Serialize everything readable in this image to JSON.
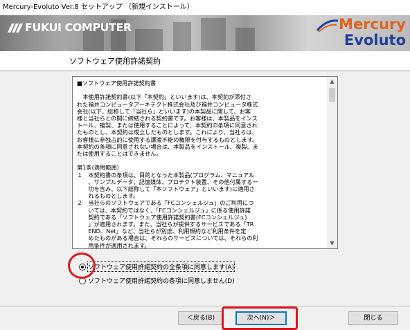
{
  "window": {
    "title": "Mercury-Evoluto Ver.8 セットアップ （新規インストール）"
  },
  "banner": {
    "left_logo": "FUKUI COMPUTER",
    "right_logo_line1": "Mercury",
    "right_logo_line2": "Evoluto",
    "colors": {
      "mercury_orange": "#e0631e",
      "evoluto_blue": "#1e3f9c"
    }
  },
  "page": {
    "heading": "ソフトウェア使用許諾契約"
  },
  "license": {
    "text": "■ソフトウェア使用許諾契約書\n\n　本使用許諾契約書(以下「本契約」といいます)は、本契約が添付さ\nれた福井コンピュータアーキテクト株式会社及び福井コンピュータ株式\n会社(以下、総称して「当社ら」といいます)の本製品に関して、お客\n様と当社らとの間に締結される契約書です。お客様は、本製品をインス\nトール、複製、または使用することによって、本契約の条項に同意され\nたものとし、本契約は成立したものとします。これにより、当社らは、\nお客様に非独占的に使用する譲渡不能の権限を付与するものとします。\n本契約の条項に同意されない場合は、本製品をインストール、複製、ま\nたは使用することはできません。\n\n第1条(適用範囲)\n１　本契約書の条項は、目的となった本製品(プログラム、マニュアル\n　　、サンプルデータ、記憶媒体、プロテクト装置、その他付属するー\n　　切を含み、以下総称して「本ソフトウェア」といいます)に適用さ\n　　れるものとします。\n２　当社らのソフトウェアである「FCコンシェルジュ」のご利用につ\n　　いては、本契約ではなく、「FCコンシェルジュ」に係る使用許諾\n　　契約である「ソフトウェア使用許諾契約書(FCコンシェルジュ)\n　　」が適用されます。また、当社らが提供するサービスである「TR\n　　END．Net」など、当社らが別途、利用規約など利用条件を定\n　　めたものがある場合は、それらのサービスについては、それらの利\n　　用条件が適用されます。"
  },
  "options": {
    "agree": "ソフトウェア使用許諾契約の全条項に同意します(A)",
    "disagree": "ソフトウェア使用許諾契約の条項に同意しません(D)",
    "selected": "agree"
  },
  "buttons": {
    "back": "＜戻る(B)",
    "next": "次へ(N)＞",
    "close": "閉じる"
  },
  "annotations": {
    "highlight_color": "#e0141e"
  }
}
